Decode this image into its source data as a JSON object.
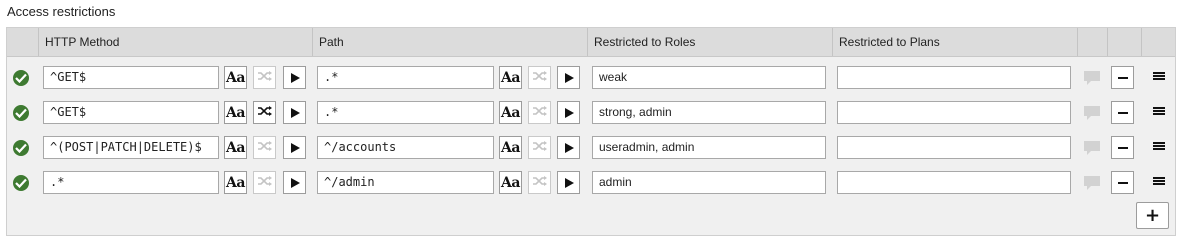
{
  "section_title": "Access restrictions",
  "columns": {
    "method": "HTTP Method",
    "path": "Path",
    "roles": "Restricted to Roles",
    "plans": "Restricted to Plans"
  },
  "rows": [
    {
      "method": "^GET$",
      "path": ".*",
      "roles": "weak",
      "plans": "",
      "shuffle_active": false
    },
    {
      "method": "^GET$",
      "path": ".*",
      "roles": "strong, admin",
      "plans": "",
      "shuffle_active": true
    },
    {
      "method": "^(POST|PATCH|DELETE)$",
      "path": "^/accounts",
      "roles": "useradmin, admin",
      "plans": "",
      "shuffle_active": false
    },
    {
      "method": ".*",
      "path": "^/admin",
      "roles": "admin",
      "plans": "",
      "shuffle_active": false
    }
  ],
  "case_icon_label": "Aa",
  "colors": {
    "header_bg": "#dcdcdc",
    "panel_bg": "#f0f0f0",
    "check_green": "#3e7a31"
  },
  "icons": {
    "status": "check-circle-icon",
    "case": "case-sensitive-icon",
    "shuffle": "shuffle-icon",
    "play": "play-icon",
    "comment": "comment-icon",
    "remove": "minus-icon",
    "drag": "drag-handle-icon",
    "add": "plus-icon"
  }
}
